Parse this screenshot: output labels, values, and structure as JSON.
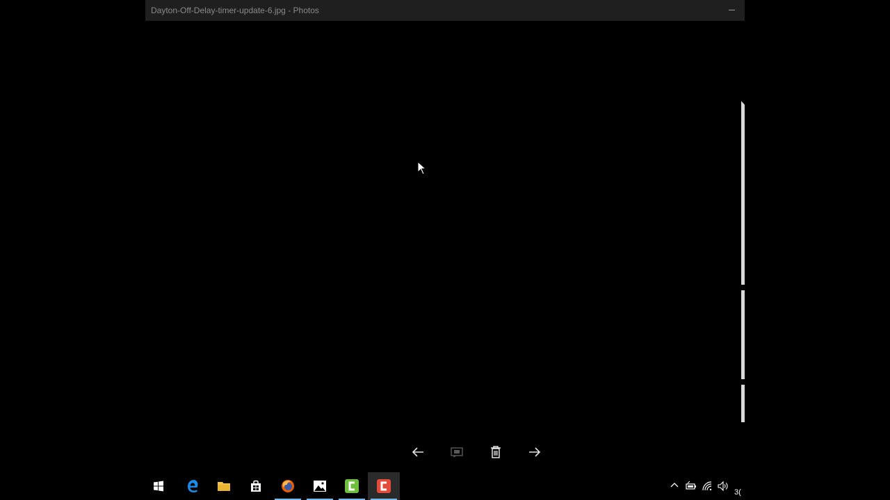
{
  "window": {
    "title": "Dayton-Off-Delay-timer-update-6.jpg - Photos",
    "minimize_label": "Minimize"
  },
  "toolbar": {
    "previous": "previous-arrow-icon",
    "slideshow": "slideshow-icon",
    "delete": "trash-icon",
    "next": "next-arrow-icon"
  },
  "taskbar": {
    "items": [
      {
        "name": "start",
        "icon": "windows-logo-icon"
      },
      {
        "name": "edge",
        "icon": "edge-icon"
      },
      {
        "name": "file-explorer",
        "icon": "folder-icon"
      },
      {
        "name": "store",
        "icon": "store-icon"
      },
      {
        "name": "firefox",
        "icon": "firefox-icon",
        "running": true
      },
      {
        "name": "photos",
        "icon": "photos-icon",
        "running": true
      },
      {
        "name": "camtasia-green",
        "icon": "camtasia-icon",
        "running": true
      },
      {
        "name": "camtasia-recorder",
        "icon": "camtasia-recorder-icon",
        "running": true,
        "active": true
      }
    ],
    "tray": {
      "icons": [
        "chevron-up-icon",
        "battery-icon",
        "wifi-icon",
        "volume-icon"
      ],
      "clock_partial": "3("
    }
  },
  "colors": {
    "accent": "#76b9ed",
    "titlebar": "#1f1f1f",
    "camtasia_green": "#6fbe3c",
    "camtasia_red": "#e34b3a"
  }
}
